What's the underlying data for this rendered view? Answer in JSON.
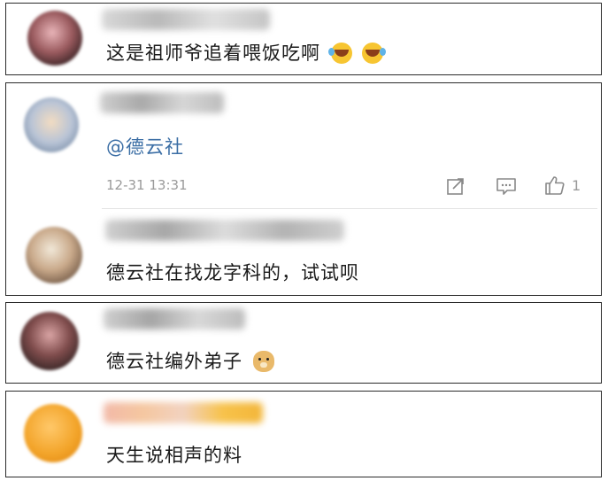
{
  "comments": [
    {
      "text": "这是祖师爷追着喂饭吃啊",
      "emoji_icon": "laughing-crying-emoji"
    },
    {
      "mention": "@德云社",
      "timestamp": "12-31 13:31",
      "actions": {
        "share_icon": "share-icon",
        "reply_icon": "comment-icon",
        "like_icon": "thumbs-up-icon",
        "like_count": "1"
      },
      "reply": {
        "text": "德云社在找龙字科的，试试呗"
      }
    },
    {
      "text": "德云社编外弟子",
      "emoji_icon": "doge-emoji"
    },
    {
      "text": "天生说相声的料"
    }
  ],
  "colors": {
    "mention": "#3b6ea5",
    "meta": "#9a9a9a",
    "border": "#2a2a2a"
  }
}
